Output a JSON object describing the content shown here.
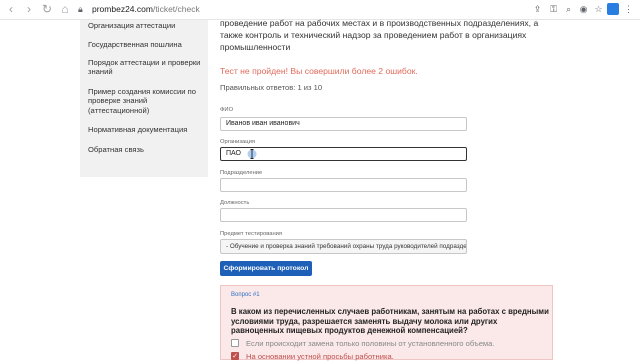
{
  "browser": {
    "url_host": "prombez24.com",
    "url_path": "/ticket/check"
  },
  "sidebar": {
    "items": [
      {
        "label": "Организация аттестации"
      },
      {
        "label": "Государственная пошлина"
      },
      {
        "label": "Порядок аттестации и проверки знаний"
      },
      {
        "label": "Пример создания комиссии по проверке знаний (аттестационной)"
      },
      {
        "label": "Нормативная документация"
      },
      {
        "label": "Обратная связь"
      }
    ]
  },
  "main": {
    "intro_lines": [
      "проведение работ на рабочих местах и в производственных подразделениях, а",
      "также контроль и технический надзор за проведением работ в организациях",
      "промышленности"
    ],
    "error": "Тест не пройден! Вы совершили более 2 ошибок.",
    "stats": "Правильных ответов: 1 из 10"
  },
  "form": {
    "fio_label": "ФИО",
    "fio_value": "Иванов иван иванович",
    "org_label": "Организация",
    "org_value": "ПАО",
    "dept_label": "Подразделение",
    "dept_value": "",
    "position_label": "Должность",
    "position_value": "",
    "subject_label": "Предмет тестирования",
    "subject_value": "- Обучение и проверка знаний требований охраны труда руководителей подразделений",
    "submit_label": "Сформировать протокол"
  },
  "question": {
    "number": "Вопрос #1",
    "text": "В каком из перечисленных случаев работникам, занятым на работах с вредными условиями труда, разрешается заменять выдачу молока или других равноценных пищевых продуктов денежной компенсацией?",
    "options": [
      {
        "label": "Если происходит замена только половины от установленного объема.",
        "checked": false
      },
      {
        "label": "На основании устной просьбы работника.",
        "checked": true
      }
    ]
  },
  "colors": {
    "accent": "#1e5fb8",
    "error": "#e06a5a",
    "card_bg": "#fbe9e9"
  }
}
